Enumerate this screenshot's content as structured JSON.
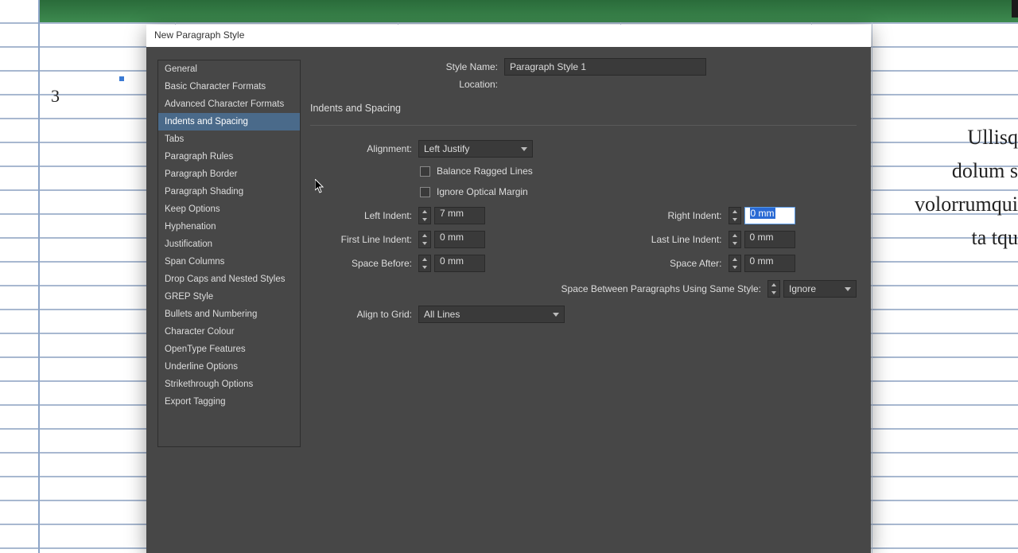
{
  "background": {
    "page_number": "3",
    "right_text_lines": [
      "Ullisq",
      "dolum s",
      "volorrumqui",
      "ta tqu"
    ]
  },
  "dialog": {
    "title": "New Paragraph Style",
    "style_name_label": "Style Name:",
    "style_name_value": "Paragraph Style 1",
    "location_label": "Location:",
    "panel_title": "Indents and Spacing",
    "sidebar": {
      "items": [
        {
          "label": "General"
        },
        {
          "label": "Basic Character Formats"
        },
        {
          "label": "Advanced Character Formats"
        },
        {
          "label": "Indents and Spacing",
          "active": true
        },
        {
          "label": "Tabs"
        },
        {
          "label": "Paragraph Rules"
        },
        {
          "label": "Paragraph Border"
        },
        {
          "label": "Paragraph Shading"
        },
        {
          "label": "Keep Options"
        },
        {
          "label": "Hyphenation"
        },
        {
          "label": "Justification"
        },
        {
          "label": "Span Columns"
        },
        {
          "label": "Drop Caps and Nested Styles"
        },
        {
          "label": "GREP Style"
        },
        {
          "label": "Bullets and Numbering"
        },
        {
          "label": "Character Colour"
        },
        {
          "label": "OpenType Features"
        },
        {
          "label": "Underline Options"
        },
        {
          "label": "Strikethrough Options"
        },
        {
          "label": "Export Tagging"
        }
      ]
    },
    "alignment": {
      "label": "Alignment:",
      "value": "Left Justify"
    },
    "balance_ragged": {
      "label": "Balance Ragged Lines",
      "checked": false
    },
    "ignore_optical": {
      "label": "Ignore Optical Margin",
      "checked": false
    },
    "left_indent": {
      "label": "Left Indent:",
      "value": "7 mm"
    },
    "right_indent": {
      "label": "Right Indent:",
      "value": "0 mm",
      "focused": true
    },
    "first_line_indent": {
      "label": "First Line Indent:",
      "value": "0 mm"
    },
    "last_line_indent": {
      "label": "Last Line Indent:",
      "value": "0 mm"
    },
    "space_before": {
      "label": "Space Before:",
      "value": "0 mm"
    },
    "space_after": {
      "label": "Space After:",
      "value": "0 mm"
    },
    "space_between_same": {
      "label": "Space Between Paragraphs Using Same Style:",
      "value": "Ignore"
    },
    "align_to_grid": {
      "label": "Align to Grid:",
      "value": "All Lines"
    }
  }
}
